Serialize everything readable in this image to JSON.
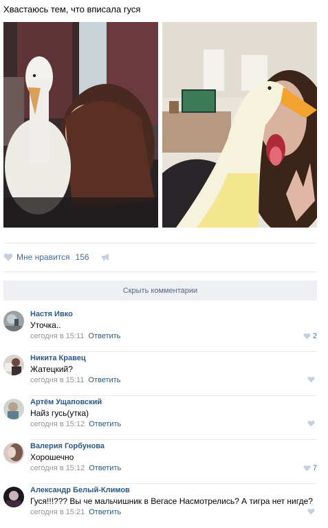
{
  "post": {
    "text": "Хвастаюсь тем, что вписала гуся"
  },
  "likes": {
    "label": "Мне нравится",
    "count": "156"
  },
  "hide_comments": "Скрыть комментарии",
  "comments": [
    {
      "author": "Настя Ивко",
      "text": "Уточка..",
      "time": "сегодня в 15:11",
      "reply": "Ответить",
      "likes": "2"
    },
    {
      "author": "Никита Кравец",
      "text": "Жатецкий?",
      "time": "сегодня в 15:11",
      "reply": "Ответить",
      "likes": ""
    },
    {
      "author": "Артём Ущаповский",
      "text": "Найз гусь(утка)",
      "time": "сегодня в 15:12",
      "reply": "Ответить",
      "likes": ""
    },
    {
      "author": "Валерия Горбунова",
      "text": "Хорошечно",
      "time": "сегодня в 15:12",
      "reply": "Ответить",
      "likes": "7"
    },
    {
      "author": "Александр Белый-Климов",
      "text": "Гуся!!!??? Вы че мальчишник в Вегасе Насмотрелись? А тигра нет нигде?",
      "time": "сегодня в 15:21",
      "reply": "Ответить",
      "likes": ""
    }
  ],
  "icons": {
    "like": "heart-icon",
    "share": "megaphone-icon"
  },
  "colors": {
    "link": "#2a5885",
    "muted": "#939393",
    "button_bg": "#eef0f3"
  }
}
